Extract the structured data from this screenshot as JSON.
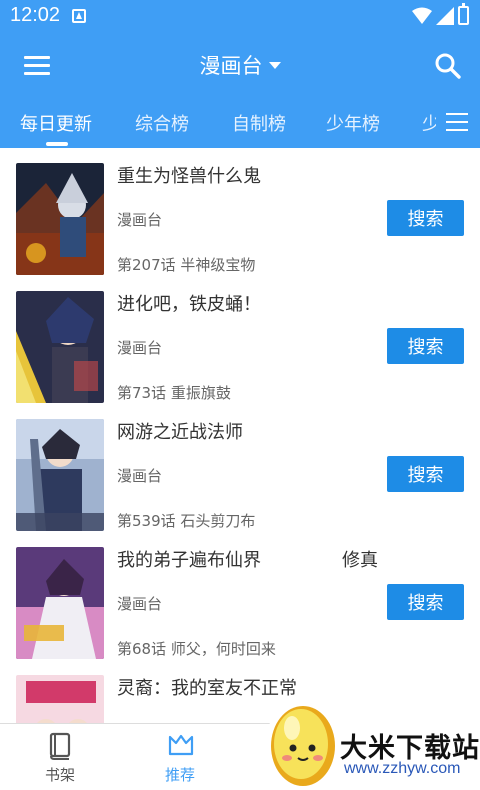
{
  "status_bar": {
    "time": "12:02"
  },
  "header": {
    "title": "漫画台"
  },
  "tabs": [
    {
      "label": "每日更新"
    },
    {
      "label": "综合榜"
    },
    {
      "label": "自制榜"
    },
    {
      "label": "少年榜"
    },
    {
      "label": "少"
    }
  ],
  "items": [
    {
      "title": "重生为怪兽什么鬼",
      "source": "漫画台",
      "latest": "第207话 半神级宝物",
      "button": "搜索"
    },
    {
      "title": "进化吧，铁皮蛹！",
      "source": "漫画台",
      "latest": "第73话 重振旗鼓",
      "button": "搜索"
    },
    {
      "title": "网游之近战法师",
      "source": "漫画台",
      "latest": "第539话 石头剪刀布",
      "button": "搜索"
    },
    {
      "title": "我的弟子遍布仙界",
      "title_extra": "修真",
      "source": "漫画台",
      "latest": "第68话 师父，何时回来",
      "button": "搜索"
    },
    {
      "title": "灵裔：我的室友不正常"
    }
  ],
  "bottom_nav": [
    {
      "label": "书架",
      "icon": "book-icon"
    },
    {
      "label": "推荐",
      "icon": "crown-icon"
    }
  ],
  "watermark": {
    "name": "大米下载站",
    "url": "www.zzhyw.com"
  },
  "colors": {
    "primary": "#3f9ef5",
    "button": "#1e8ce6",
    "nav_active": "#3f9ef5",
    "nav_inactive": "#555555"
  }
}
